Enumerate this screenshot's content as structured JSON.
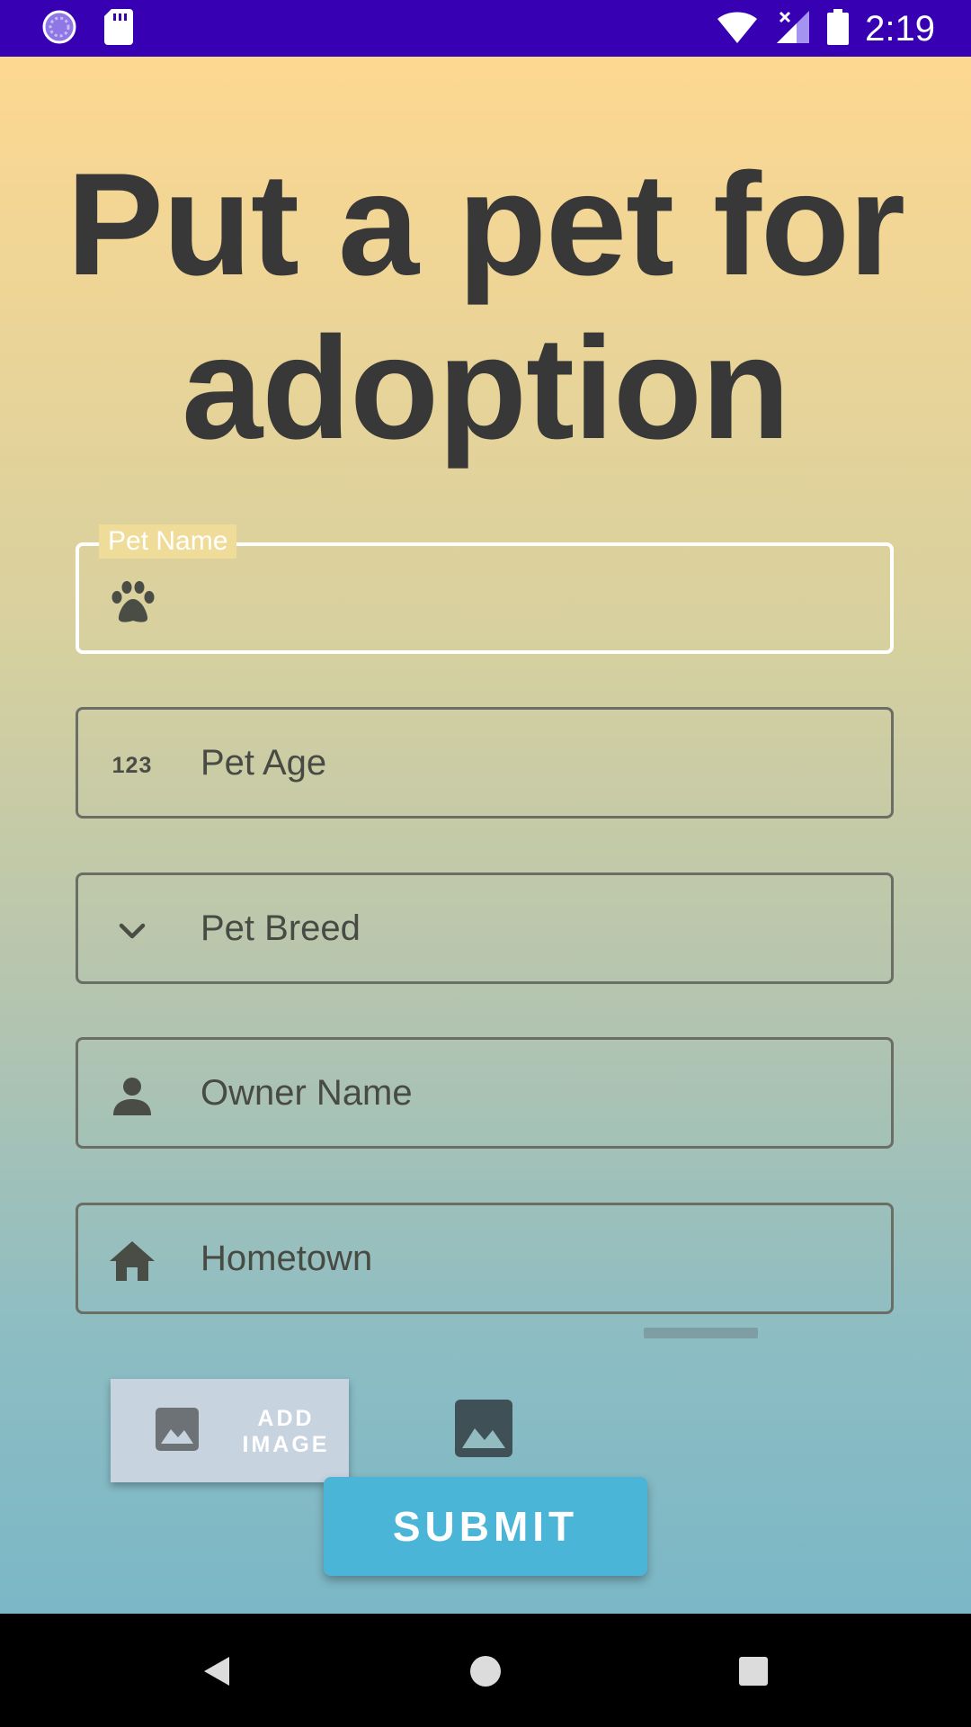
{
  "status_bar": {
    "time": "2:19",
    "icons": [
      "sync-icon",
      "sd-card-icon",
      "wifi-icon",
      "signal-icon",
      "battery-icon"
    ]
  },
  "page": {
    "title": "Put a pet for adoption"
  },
  "form": {
    "pet_name": {
      "label": "Pet Name",
      "value": "",
      "icon": "paw-icon"
    },
    "pet_age": {
      "label": "Pet Age",
      "icon": "numeric-icon",
      "icon_text": "123"
    },
    "pet_breed": {
      "label": "Pet Breed",
      "icon": "chevron-down-icon"
    },
    "owner_name": {
      "label": "Owner Name",
      "icon": "person-icon"
    },
    "hometown": {
      "label": "Hometown",
      "icon": "home-icon"
    }
  },
  "actions": {
    "add_image_label": "ADD\nIMAGE",
    "submit_label": "SUBMIT"
  },
  "nav": {
    "icons": [
      "back-icon",
      "home-circle-icon",
      "recents-icon"
    ]
  },
  "colors": {
    "status_bar": "#3700b3",
    "submit": "#4ab5d6",
    "gradient_top": "#fdd891",
    "gradient_bottom": "#7bb7c6"
  }
}
